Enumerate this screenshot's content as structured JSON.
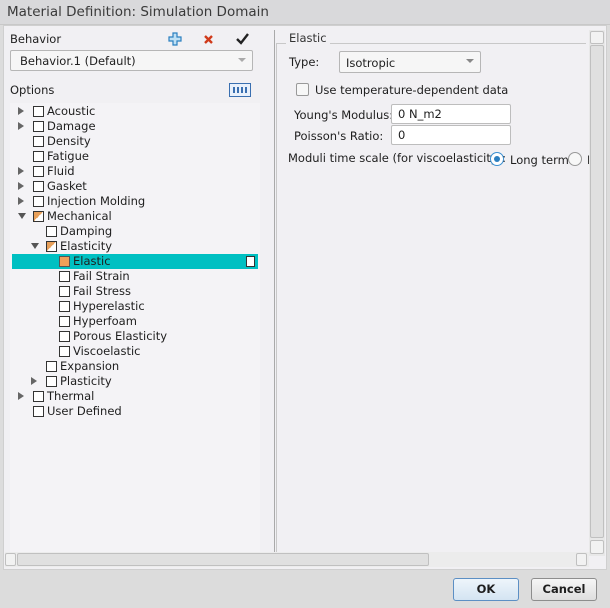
{
  "window": {
    "title": "Material Definition: Simulation Domain"
  },
  "behavior": {
    "label": "Behavior",
    "selected": "Behavior.1 (Default)",
    "icons": [
      "add-icon",
      "delete-icon",
      "check-icon"
    ]
  },
  "options": {
    "label": "Options",
    "tree": [
      {
        "label": "Acoustic",
        "level": 0,
        "expander": "collapsed",
        "check": "none"
      },
      {
        "label": "Damage",
        "level": 0,
        "expander": "collapsed",
        "check": "none"
      },
      {
        "label": "Density",
        "level": 0,
        "expander": "",
        "check": "none"
      },
      {
        "label": "Fatigue",
        "level": 0,
        "expander": "",
        "check": "none"
      },
      {
        "label": "Fluid",
        "level": 0,
        "expander": "collapsed",
        "check": "none"
      },
      {
        "label": "Gasket",
        "level": 0,
        "expander": "collapsed",
        "check": "none"
      },
      {
        "label": "Injection Molding",
        "level": 0,
        "expander": "collapsed",
        "check": "none"
      },
      {
        "label": "Mechanical",
        "level": 0,
        "expander": "expanded",
        "check": "partial"
      },
      {
        "label": "Damping",
        "level": 1,
        "expander": "",
        "check": "none"
      },
      {
        "label": "Elasticity",
        "level": 1,
        "expander": "expanded",
        "check": "partial"
      },
      {
        "label": "Elastic",
        "level": 2,
        "expander": "",
        "check": "full",
        "selected": true
      },
      {
        "label": "Fail Strain",
        "level": 2,
        "expander": "",
        "check": "none"
      },
      {
        "label": "Fail Stress",
        "level": 2,
        "expander": "",
        "check": "none"
      },
      {
        "label": "Hyperelastic",
        "level": 2,
        "expander": "",
        "check": "none"
      },
      {
        "label": "Hyperfoam",
        "level": 2,
        "expander": "",
        "check": "none"
      },
      {
        "label": "Porous Elasticity",
        "level": 2,
        "expander": "",
        "check": "none"
      },
      {
        "label": "Viscoelastic",
        "level": 2,
        "expander": "",
        "check": "none"
      },
      {
        "label": "Expansion",
        "level": 1,
        "expander": "",
        "check": "none"
      },
      {
        "label": "Plasticity",
        "level": 1,
        "expander": "collapsed",
        "check": "none"
      },
      {
        "label": "Thermal",
        "level": 0,
        "expander": "collapsed",
        "check": "none"
      },
      {
        "label": "User Defined",
        "level": 0,
        "expander": "",
        "check": "none"
      }
    ]
  },
  "elastic": {
    "group_label": "Elastic",
    "type_label": "Type:",
    "type_value": "Isotropic",
    "temp_label": "Use temperature-dependent data",
    "temp_checked": false,
    "youngs_label": "Young's Modulus:",
    "youngs_value": "0 N_m2",
    "poisson_label": "Poisson's Ratio:",
    "poisson_value": "0",
    "moduli_label": "Moduli time scale (for viscoelasticity):",
    "long_term_label": "Long term",
    "long_term_selected": true,
    "instantaneous_label": "I"
  },
  "footer": {
    "ok": "OK",
    "cancel": "Cancel"
  },
  "colors": {
    "selection": "#00c0c2",
    "accent": "#2b7fc0"
  }
}
